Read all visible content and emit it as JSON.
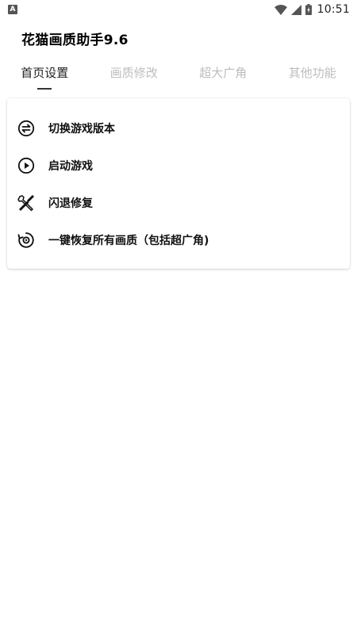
{
  "status_bar": {
    "notification_icon": "A",
    "time": "10:51"
  },
  "app": {
    "title": "花猫画质助手9.6"
  },
  "tabs": [
    {
      "label": "首页设置",
      "active": true
    },
    {
      "label": "画质修改",
      "active": false
    },
    {
      "label": "超大广角",
      "active": false
    },
    {
      "label": "其他功能",
      "active": false
    }
  ],
  "menu": {
    "items": [
      {
        "label": "切换游戏版本",
        "icon": "swap-icon"
      },
      {
        "label": "启动游戏",
        "icon": "play-icon"
      },
      {
        "label": "闪退修复",
        "icon": "tools-icon"
      },
      {
        "label": "一键恢复所有画质（包括超广角)",
        "icon": "restore-icon"
      }
    ]
  },
  "colors": {
    "active_tab": "#222222",
    "inactive_tab": "#bdbdbd",
    "background": "#ffffff"
  }
}
